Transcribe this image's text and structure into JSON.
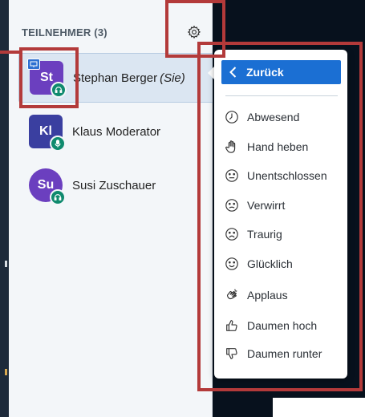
{
  "participants": {
    "header": "TEILNEHMER (3)",
    "users": [
      {
        "initials": "St",
        "name": "Stephan Berger",
        "suffix": "(Sie)",
        "color": "#6b3fbf",
        "shape": "square",
        "presenter": true,
        "status_icon": "headphones-icon",
        "badge_color": "#0f8a6e"
      },
      {
        "initials": "Kl",
        "name": "Klaus Moderator",
        "suffix": "",
        "color": "#3a3fa0",
        "shape": "square",
        "presenter": false,
        "status_icon": "microphone-icon",
        "badge_color": "#0f8a6e"
      },
      {
        "initials": "Su",
        "name": "Susi Zuschauer",
        "suffix": "",
        "color": "#6b3fbf",
        "shape": "circle",
        "presenter": false,
        "status_icon": "headphones-icon",
        "badge_color": "#0f8a6e"
      }
    ]
  },
  "status_menu": {
    "back_label": "Zurück",
    "items": [
      {
        "label": "Abwesend",
        "icon": "clock-icon"
      },
      {
        "label": "Hand heben",
        "icon": "raised-hand-icon"
      },
      {
        "label": "Unentschlossen",
        "icon": "neutral-face-icon"
      },
      {
        "label": "Verwirrt",
        "icon": "confused-face-icon"
      },
      {
        "label": "Traurig",
        "icon": "sad-face-icon"
      },
      {
        "label": "Glücklich",
        "icon": "happy-face-icon"
      },
      {
        "label": "Applaus",
        "icon": "applause-icon"
      },
      {
        "label": "Daumen hoch",
        "icon": "thumbs-up-icon"
      },
      {
        "label": "Daumen runter",
        "icon": "thumbs-down-icon"
      }
    ]
  },
  "colors": {
    "accent": "#1b6fd3",
    "highlight": "#b33a3a",
    "badge": "#0f8a6e"
  }
}
